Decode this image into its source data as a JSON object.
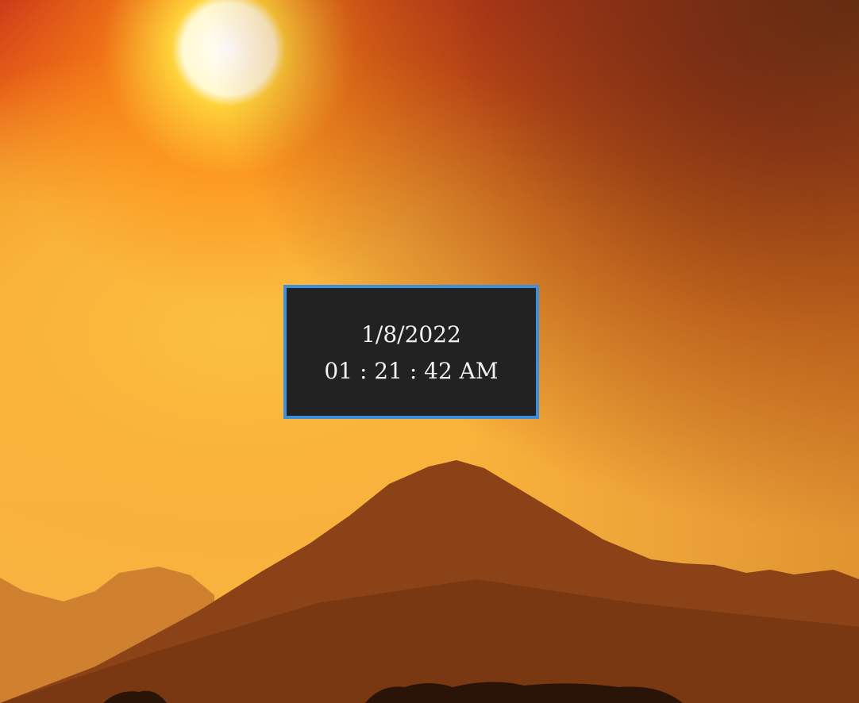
{
  "clock": {
    "date": "1/8/2022",
    "time": "01 : 21 : 42 AM",
    "border_color": "#3d8fdc",
    "background_color": "#222222"
  },
  "wallpaper": {
    "subject": "sunset-over-mountains"
  }
}
